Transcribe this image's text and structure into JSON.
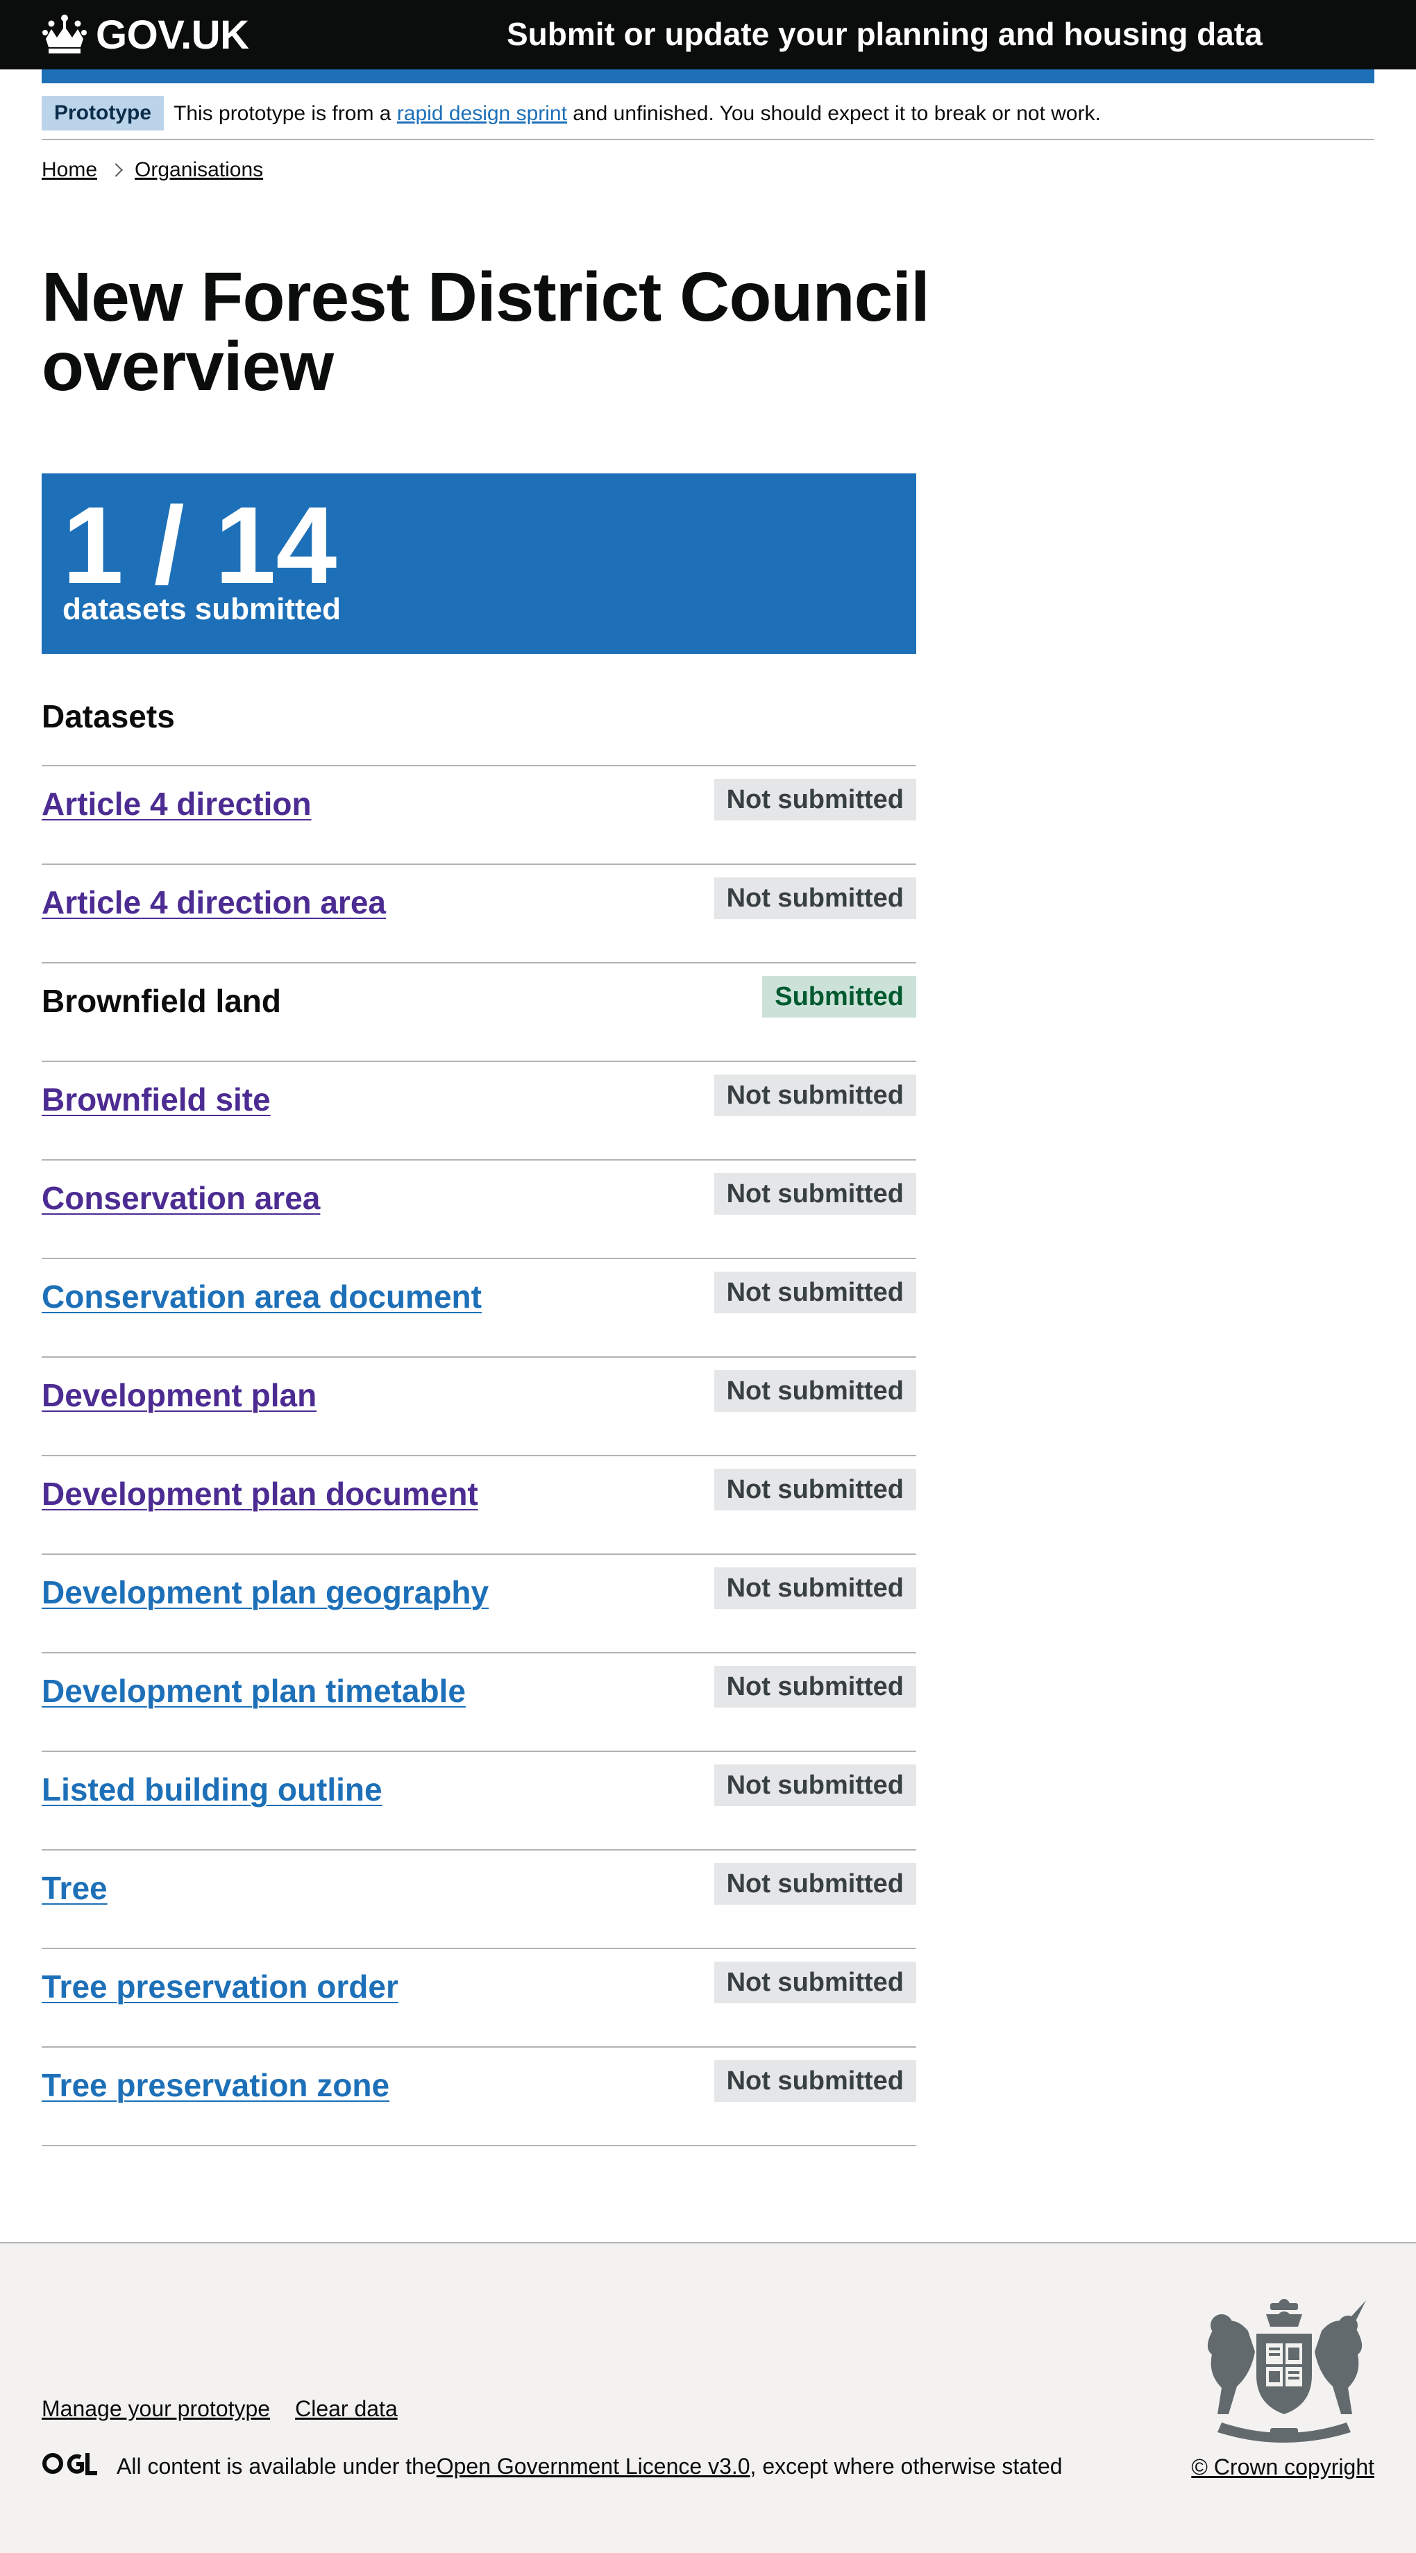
{
  "header": {
    "logo_text": "GOV.UK",
    "service_name": "Submit or update your planning and housing data"
  },
  "phase_banner": {
    "tag": "Prototype",
    "text_before": "This prototype is from a ",
    "link": "rapid design sprint",
    "text_after": " and unfinished. You should expect it to break or not work."
  },
  "breadcrumbs": [
    {
      "label": "Home"
    },
    {
      "label": "Organisations"
    }
  ],
  "page_title": "New Forest District Council overview",
  "summary": {
    "count": "1 / 14",
    "label": "datasets submitted"
  },
  "datasets_heading": "Datasets",
  "datasets": [
    {
      "name": "Article 4 direction",
      "status": "Not submitted"
    },
    {
      "name": "Article 4 direction area",
      "status": "Not submitted"
    },
    {
      "name": "Brownfield land",
      "status": "Submitted"
    },
    {
      "name": "Brownfield site",
      "status": "Not submitted"
    },
    {
      "name": "Conservation area",
      "status": "Not submitted"
    },
    {
      "name": "Conservation area document",
      "status": "Not submitted"
    },
    {
      "name": "Development plan",
      "status": "Not submitted"
    },
    {
      "name": "Development plan document",
      "status": "Not submitted"
    },
    {
      "name": "Development plan geography",
      "status": "Not submitted"
    },
    {
      "name": "Development plan timetable",
      "status": "Not submitted"
    },
    {
      "name": "Listed building outline",
      "status": "Not submitted"
    },
    {
      "name": "Tree",
      "status": "Not submitted"
    },
    {
      "name": "Tree preservation order",
      "status": "Not submitted"
    },
    {
      "name": "Tree preservation zone",
      "status": "Not submitted"
    }
  ],
  "footer": {
    "links": [
      "Manage your prototype",
      "Clear data"
    ],
    "licence_before": "All content is available under the ",
    "licence_link": "Open Government Licence v3.0",
    "licence_after": ", except where otherwise stated",
    "copyright": "© Crown copyright"
  },
  "colors": {
    "header_bg": "#0b0c0c",
    "brand_blue": "#1d70b8",
    "visited_link": "#4c2c92",
    "tag_grey_bg": "#e5e6e7",
    "tag_green_bg": "#cce2d8",
    "tag_green_text": "#005a30",
    "footer_bg": "#f3f2f1"
  },
  "icons": {
    "logo": "crown-icon",
    "breadcrumb_separator": "chevron-right-icon",
    "licence": "ogl-logo",
    "footer_crest": "royal-coat-of-arms"
  }
}
